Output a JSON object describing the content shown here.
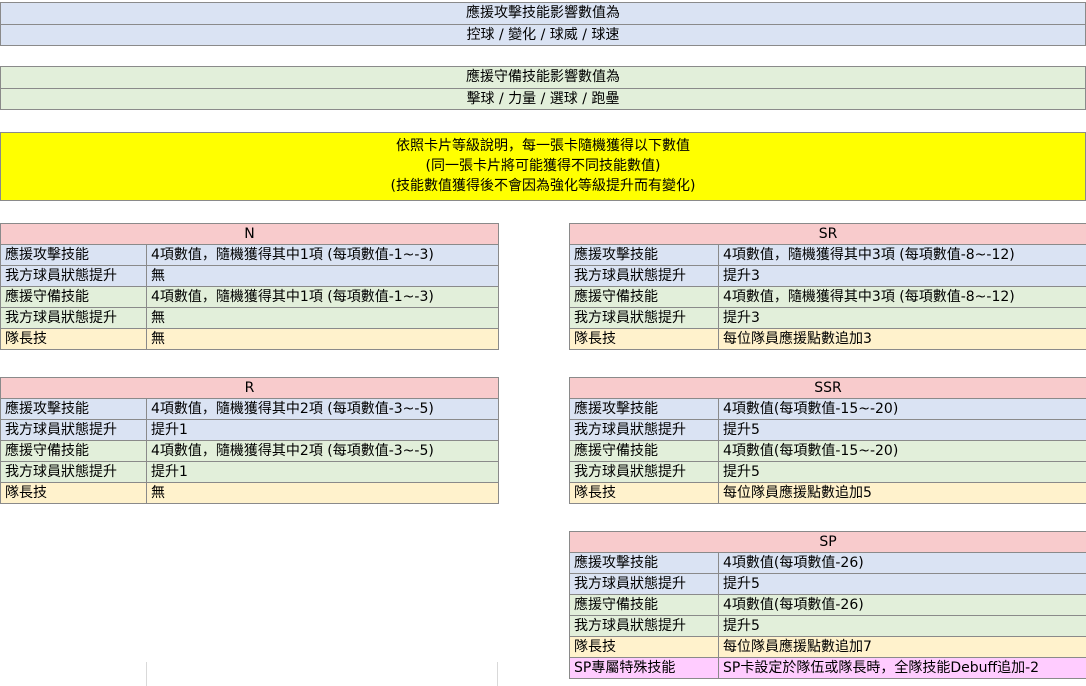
{
  "attack_band": {
    "title": "應援攻擊技能影響數值為",
    "stats": "控球 / 變化 / 球威 / 球速"
  },
  "defense_band": {
    "title": "應援守備技能影響數值為",
    "stats": "擊球 / 力量 / 選球 / 跑壘"
  },
  "note": {
    "line1": "依照卡片等級說明，每一張卡隨機獲得以下數值",
    "line2": "(同一張卡片將可能獲得不同技能數值)",
    "line3": "(技能數值獲得後不會因為強化等級提升而有變化)"
  },
  "tiers": {
    "N": {
      "label": "N",
      "rows": [
        [
          "應援攻擊技能",
          "4項數值，隨機獲得其中1項 (每項數值-1~-3)"
        ],
        [
          "我方球員狀態提升",
          "無"
        ],
        [
          "應援守備技能",
          "4項數值，隨機獲得其中1項 (每項數值-1~-3)"
        ],
        [
          "我方球員狀態提升",
          "無"
        ],
        [
          "隊長技",
          "無"
        ]
      ]
    },
    "R": {
      "label": "R",
      "rows": [
        [
          "應援攻擊技能",
          "4項數值，隨機獲得其中2項 (每項數值-3~-5)"
        ],
        [
          "我方球員狀態提升",
          "提升1"
        ],
        [
          "應援守備技能",
          "4項數值，隨機獲得其中2項 (每項數值-3~-5)"
        ],
        [
          "我方球員狀態提升",
          "提升1"
        ],
        [
          "隊長技",
          "無"
        ]
      ]
    },
    "SR": {
      "label": "SR",
      "rows": [
        [
          "應援攻擊技能",
          "4項數值，隨機獲得其中3項 (每項數值-8~-12)"
        ],
        [
          "我方球員狀態提升",
          "提升3"
        ],
        [
          "應援守備技能",
          "4項數值，隨機獲得其中3項 (每項數值-8~-12)"
        ],
        [
          "我方球員狀態提升",
          "提升3"
        ],
        [
          "隊長技",
          "每位隊員應援點數追加3"
        ]
      ]
    },
    "SSR": {
      "label": "SSR",
      "rows": [
        [
          "應援攻擊技能",
          "4項數值(每項數值-15~-20)"
        ],
        [
          "我方球員狀態提升",
          "提升5"
        ],
        [
          "應援守備技能",
          "4項數值(每項數值-15~-20)"
        ],
        [
          "我方球員狀態提升",
          "提升5"
        ],
        [
          "隊長技",
          "每位隊員應援點數追加5"
        ]
      ]
    },
    "SP": {
      "label": "SP",
      "rows": [
        [
          "應援攻擊技能",
          "4項數值(每項數值-26)"
        ],
        [
          "我方球員狀態提升",
          "提升5"
        ],
        [
          "應援守備技能",
          "4項數值(每項數值-26)"
        ],
        [
          "我方球員狀態提升",
          "提升5"
        ],
        [
          "隊長技",
          "每位隊員應援點數追加7"
        ],
        [
          "SP專屬特殊技能",
          "SP卡設定於隊伍或隊長時，全隊技能Debuff追加-2"
        ]
      ]
    }
  },
  "colors": {
    "header": "#f8cbcc",
    "attack": "#dae3f3",
    "defense": "#e2efda",
    "captain": "#fff2cc",
    "special": "#ffccff",
    "note": "#ffff00"
  }
}
